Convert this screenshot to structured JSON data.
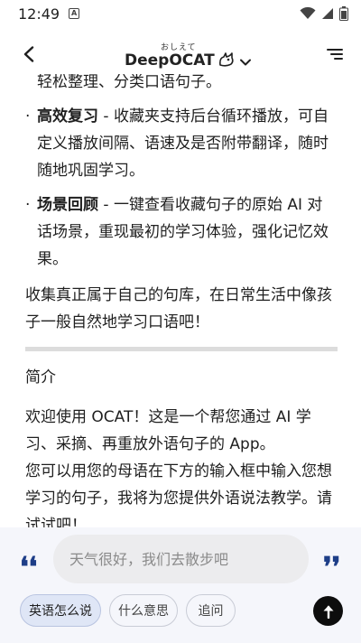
{
  "status_bar": {
    "time": "12:49",
    "notification_glyph": "A"
  },
  "header": {
    "brand_name": "DeepOCAT",
    "brand_ruby": "おしえて"
  },
  "content": {
    "partial_line": "轻松整理、分类口语句子。",
    "bullets": [
      {
        "title": "高效复习",
        "text": " - 收藏夹支持后台循环播放，可自定义播放间隔、语速及是否附带翻译，随时随地巩固学习。"
      },
      {
        "title": "场景回顾",
        "text": " - 一键查看收藏句子的原始 AI 对话场景，重现最初的学习体验，强化记忆效果。"
      }
    ],
    "closing": "收集真正属于自己的句库，在日常生活中像孩子一般自然地学习口语吧！",
    "section_title": "简介",
    "intro_1": "欢迎使用 OCAT！这是一个帮您通过 AI 学习、采摘、再重放外语句子的 App。",
    "intro_2": "您可以用您的母语在下方的输入框中输入您想学习的句子，我将为您提供外语说法教学。请试试吧！"
  },
  "input": {
    "placeholder": "天气很好，我们去散步吧",
    "value": ""
  },
  "chips": [
    "英语怎么说",
    "什么意思",
    "追问"
  ],
  "icons": {
    "status": [
      "wifi-icon",
      "signal-icon",
      "battery-icon"
    ],
    "header": [
      "back-arrow-icon",
      "cat-logo-icon",
      "chevron-down-icon",
      "menu-icon"
    ],
    "bottom": [
      "quote-open-icon",
      "quote-close-icon",
      "arrow-up-icon"
    ]
  },
  "colors": {
    "quote_accent": "#1e3e88",
    "chip_active_bg": "#dfe6f6",
    "send_button": "#0d0d0d"
  }
}
